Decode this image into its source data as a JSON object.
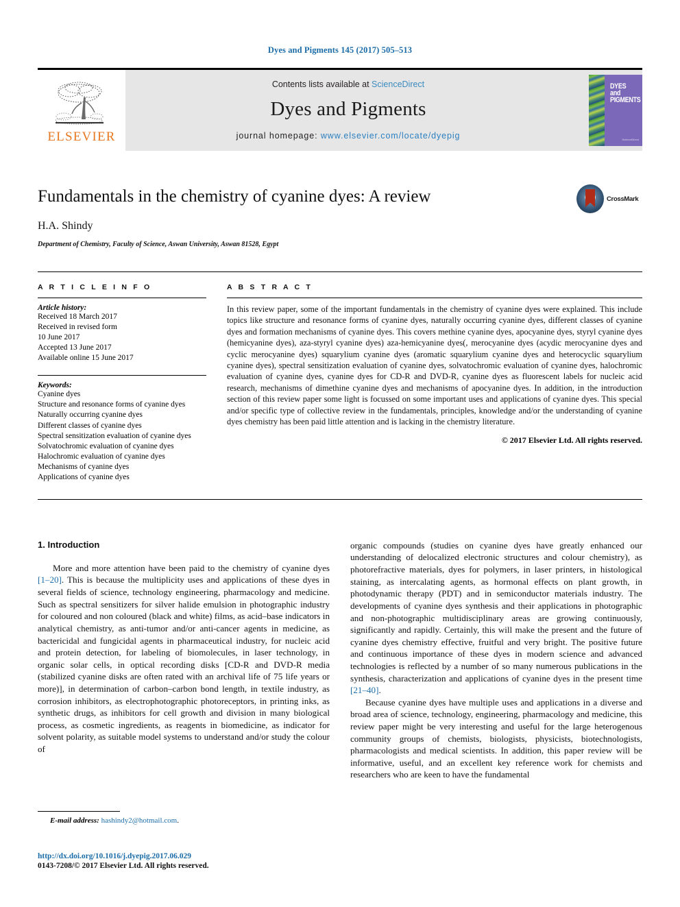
{
  "running_head": "Dyes and Pigments 145 (2017) 505–513",
  "masthead": {
    "publisher_wordmark": "ELSEVIER",
    "contents_prefix": "Contents lists available at ",
    "contents_link": "ScienceDirect",
    "journal_name": "Dyes and Pigments",
    "homepage_prefix": "journal homepage: ",
    "homepage_url": "www.elsevier.com/locate/dyepig",
    "cover_title": "DYES and PIGMENTS",
    "cover_publisher": "published by\nScienceDirect\nwww.sciencedirect.com"
  },
  "article": {
    "title": "Fundamentals in the chemistry of cyanine dyes: A review",
    "authors": "H.A. Shindy",
    "affiliation": "Department of Chemistry, Faculty of Science, Aswan University, Aswan 81528, Egypt",
    "crossmark_label": "CrossMark"
  },
  "article_info": {
    "heading": "A R T I C L E  I N F O",
    "history_label": "Article history:",
    "history": [
      "Received 18 March 2017",
      "Received in revised form",
      "10 June 2017",
      "Accepted 13 June 2017",
      "Available online 15 June 2017"
    ],
    "keywords_label": "Keywords:",
    "keywords": [
      "Cyanine dyes",
      "Structure and resonance forms of cyanine dyes",
      "Naturally occurring cyanine dyes",
      "Different classes of cyanine dyes",
      "Spectral sensitization evaluation of cyanine dyes",
      "Solvatochromic evaluation of cyanine dyes",
      "Halochromic evaluation of cyanine dyes",
      "Mechanisms of cyanine dyes",
      "Applications of cyanine dyes"
    ]
  },
  "abstract": {
    "heading": "A B S T R A C T",
    "text": "In this review paper, some of the important fundamentals in the chemistry of cyanine dyes were explained. This include topics like structure and resonance forms of cyanine dyes, naturally occurring cyanine dyes, different classes of cyanine dyes and formation mechanisms of cyanine dyes. This covers methine cyanine dyes, apocyanine dyes, styryl cyanine dyes (hemicyanine dyes), aza-styryl cyanine dyes) aza-hemicyanine dyes(, merocyanine dyes (acydic merocyanine dyes and cyclic merocyanine dyes) squarylium cyanine dyes (aromatic squarylium cyanine dyes and heterocyclic squarylium cyanine dyes), spectral sensitization evaluation of cyanine dyes, solvatochromic evaluation of cyanine dyes, halochromic evaluation of cyanine dyes, cyanine dyes for CD-R and DVD-R, cyanine dyes as fluorescent labels for nucleic acid research, mechanisms of dimethine cyanine dyes and mechanisms of apocyanine dyes. In addition, in the introduction section of this review paper some light is focussed on some important uses and applications of cyanine dyes. This special and/or specific type of collective review in the fundamentals, principles, knowledge and/or the understanding of cyanine dyes chemistry has been paid little attention and is lacking in the chemistry literature.",
    "copyright": "© 2017 Elsevier Ltd. All rights reserved."
  },
  "introduction": {
    "heading": "1. Introduction",
    "left_paragraph_1_a": "More and more attention have been paid to the chemistry of cyanine dyes ",
    "left_paragraph_1_ref": "[1–20]",
    "left_paragraph_1_b": ". This is because the multiplicity uses and applications of these dyes in several fields of science, technology engineering, pharmacology and medicine. Such as spectral sensitizers for silver halide emulsion in photographic industry for coloured and non coloured (black and white) films, as acid–base indicators in analytical chemistry, as anti-tumor and/or anti-cancer agents in medicine, as bactericidal and fungicidal agents in pharmaceutical industry, for nucleic acid and protein detection, for labeling of biomolecules, in laser technology, in organic solar cells, in optical recording disks [CD-R and DVD-R media (stabilized cyanine disks are often rated with an archival life of 75 life years or more)], in determination of carbon–carbon bond length, in textile industry, as corrosion inhibitors, as electrophotographic photoreceptors, in printing inks, as synthetic drugs, as inhibitors for cell growth and division in many biological process, as cosmetic ingredients, as reagents in biomedicine, as indicator for solvent polarity, as suitable model systems to understand and/or study the colour of",
    "right_paragraph_1_a": "organic compounds (studies on cyanine dyes have greatly enhanced our understanding of delocalized electronic structures and colour chemistry), as photorefractive materials, dyes for polymers, in laser printers, in histological staining, as intercalating agents, as hormonal effects on plant growth, in photodynamic therapy (PDT) and in semiconductor materials industry. The developments of cyanine dyes synthesis and their applications in photographic and non-photographic multidisciplinary areas are growing continuously, significantly and rapidly. Certainly, this will make the present and the future of cyanine dyes chemistry effective, fruitful and very bright. The positive future and continuous importance of these dyes in modern science and advanced technologies is reflected by a number of so many numerous publications in the synthesis, characterization and applications of cyanine dyes in the present time ",
    "right_paragraph_1_ref": "[21–40]",
    "right_paragraph_1_b": ".",
    "right_paragraph_2": "Because cyanine dyes have multiple uses and applications in a diverse and broad area of science, technology, engineering, pharmacology and medicine, this review paper might be very interesting and useful for the large heterogenous community groups of chemists, biologists, physicists, biotechnologists, pharmacologists and medical scientists. In addition, this paper review will be informative, useful, and an excellent key reference work for chemists and researchers who are keen to have the fundamental"
  },
  "footer": {
    "email_label": "E-mail address:",
    "email": "hashindy2@hotmail.com",
    "email_suffix": ".",
    "doi": "http://dx.doi.org/10.1016/j.dyepig.2017.06.029",
    "issn": "0143-7208/© 2017 Elsevier Ltd. All rights reserved."
  },
  "colors": {
    "link_blue": "#1b6ca8",
    "elsevier_orange": "#E87722",
    "masthead_grey": "#e6e6e6",
    "cover_purple": "#7b68b8"
  }
}
